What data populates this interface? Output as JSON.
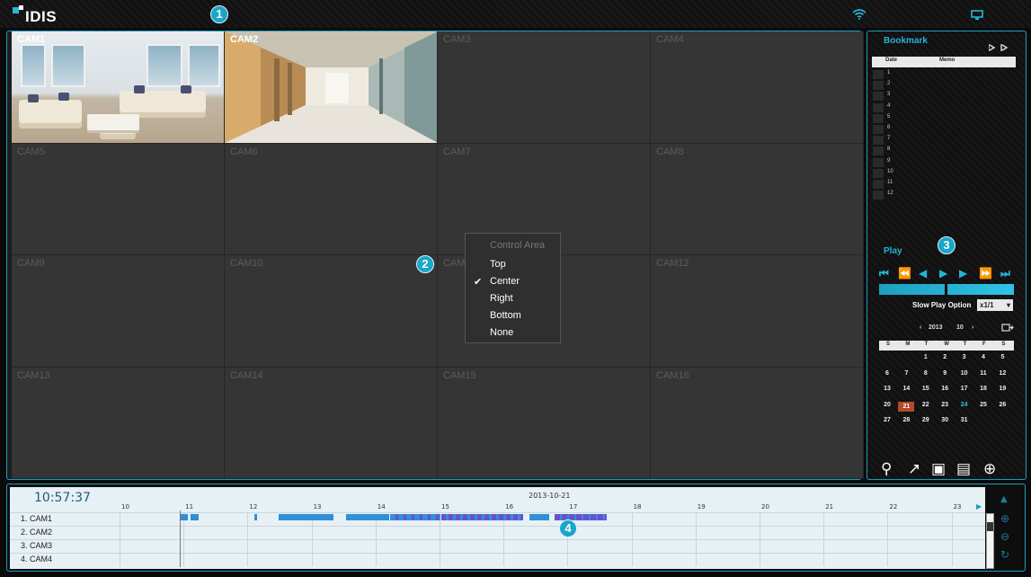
{
  "app": {
    "logo_text": "IDIS"
  },
  "badges": {
    "b1": "1",
    "b2": "2",
    "b3": "3",
    "b4": "4"
  },
  "cameras": [
    "CAM1",
    "CAM2",
    "CAM3",
    "CAM4",
    "CAM5",
    "CAM6",
    "CAM7",
    "CAM8",
    "CAM9",
    "CAM10",
    "CAM11",
    "CAM12",
    "CAM13",
    "CAM14",
    "CAM15",
    "CAM16"
  ],
  "context_menu": {
    "title": "Control Area",
    "items": [
      "Top",
      "Center",
      "Right",
      "Bottom",
      "None"
    ],
    "checked": "Center"
  },
  "bookmark": {
    "title": "Bookmark",
    "col_date": "Date",
    "col_memo": "Memo",
    "rows": [
      "1",
      "2",
      "3",
      "4",
      "5",
      "6",
      "7",
      "8",
      "9",
      "10",
      "11",
      "12"
    ]
  },
  "play": {
    "title": "Play",
    "slow_label": "Slow Play Option",
    "slow_value": "x1/1"
  },
  "calendar": {
    "year": "2013",
    "month": "10",
    "dow": [
      "S",
      "M",
      "T",
      "W",
      "T",
      "F",
      "S"
    ],
    "weeks": [
      [
        "",
        "",
        "1",
        "2",
        "3",
        "4",
        "5"
      ],
      [
        "6",
        "7",
        "8",
        "9",
        "10",
        "11",
        "12"
      ],
      [
        "13",
        "14",
        "15",
        "16",
        "17",
        "18",
        "19"
      ],
      [
        "20",
        "21",
        "22",
        "23",
        "24",
        "25",
        "26"
      ],
      [
        "27",
        "28",
        "29",
        "30",
        "31",
        "",
        ""
      ]
    ],
    "highlight_red": "21",
    "highlight_blue": "24"
  },
  "timeline": {
    "clock": "10:57:37",
    "date": "2013-10-21",
    "hours": [
      "10",
      "11",
      "12",
      "13",
      "14",
      "15",
      "16",
      "17",
      "18",
      "19",
      "20",
      "21",
      "22",
      "23"
    ],
    "channels": [
      "1. CAM1",
      "2. CAM2",
      "3. CAM3",
      "4. CAM4"
    ]
  },
  "colors": {
    "accent": "#1a9dbf",
    "record_normal": "#2f8fd8",
    "record_event": "#6a4fd0"
  }
}
